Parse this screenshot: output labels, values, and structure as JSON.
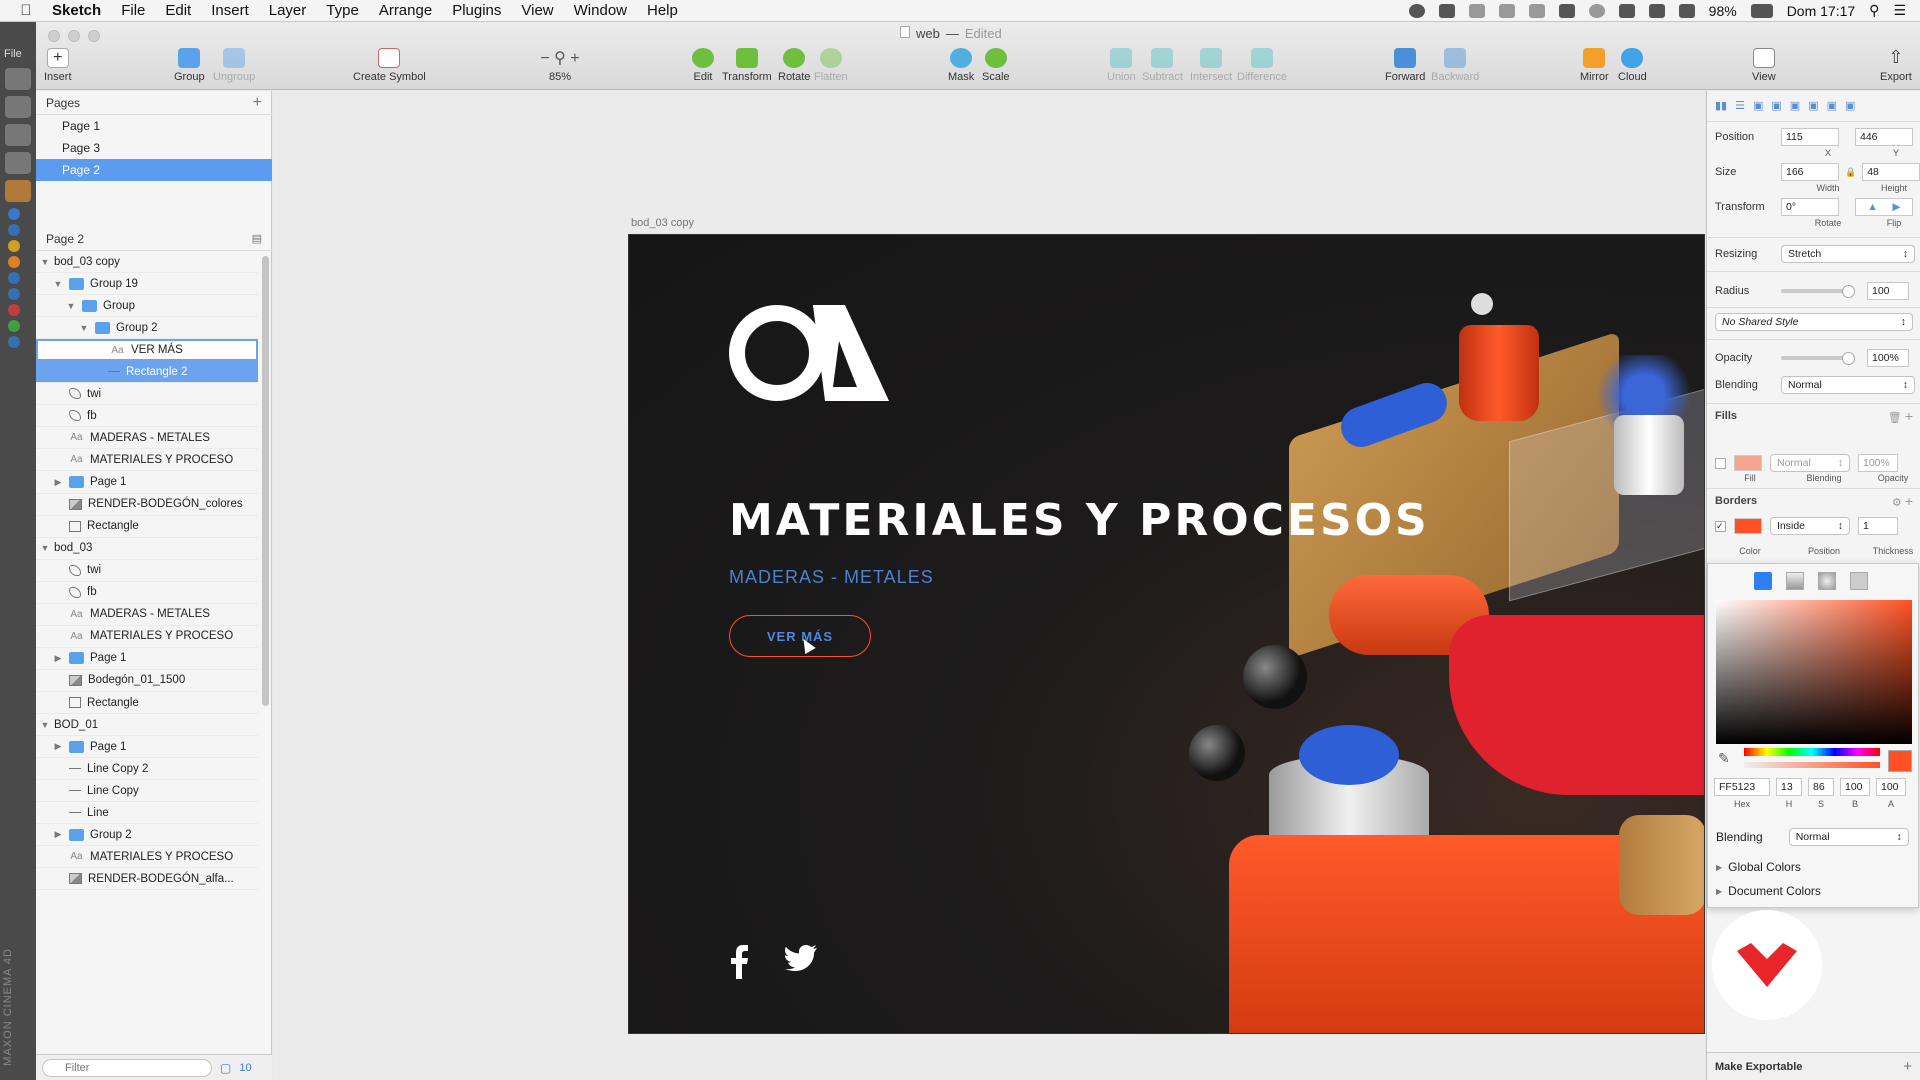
{
  "menubar": {
    "app": "Sketch",
    "items": [
      "File",
      "Edit",
      "Insert",
      "Layer",
      "Type",
      "Arrange",
      "Plugins",
      "View",
      "Window",
      "Help"
    ],
    "battery": "98%",
    "clock": "Dom 17:17"
  },
  "window": {
    "title": "web",
    "status": "Edited"
  },
  "toolbar": {
    "insert": "Insert",
    "group": "Group",
    "ungroup": "Ungroup",
    "create_symbol": "Create Symbol",
    "zoom": "85%",
    "edit": "Edit",
    "transform": "Transform",
    "rotate": "Rotate",
    "flatten": "Flatten",
    "mask": "Mask",
    "scale": "Scale",
    "union": "Union",
    "subtract": "Subtract",
    "intersect": "Intersect",
    "difference": "Difference",
    "forward": "Forward",
    "backward": "Backward",
    "mirror": "Mirror",
    "cloud": "Cloud",
    "view": "View",
    "export": "Export"
  },
  "dock": {
    "file_label": "File",
    "brand": "MAXON CINEMA 4D"
  },
  "pages": {
    "header": "Pages",
    "items": [
      {
        "label": "Page 1",
        "selected": false
      },
      {
        "label": "Page 3",
        "selected": false
      },
      {
        "label": "Page 2",
        "selected": true
      }
    ]
  },
  "layers": {
    "header": "Page 2",
    "items": [
      {
        "label": "bod_03 copy",
        "indent": 0,
        "icon": "none",
        "tri": "open"
      },
      {
        "label": "Group 19",
        "indent": 1,
        "icon": "folder",
        "tri": "open"
      },
      {
        "label": "Group",
        "indent": 2,
        "icon": "folder",
        "tri": "open"
      },
      {
        "label": "Group 2",
        "indent": 3,
        "icon": "folder",
        "tri": "open"
      },
      {
        "label": "VER MÁS",
        "indent": 4,
        "icon": "text",
        "tri": "none",
        "state": "selbox"
      },
      {
        "label": "Rectangle 2",
        "indent": 4,
        "icon": "line",
        "tri": "none",
        "state": "sel"
      },
      {
        "label": "twi",
        "indent": 1,
        "icon": "path",
        "tri": "none"
      },
      {
        "label": "fb",
        "indent": 1,
        "icon": "path",
        "tri": "none"
      },
      {
        "label": "MADERAS - METALES",
        "indent": 1,
        "icon": "text",
        "tri": "none"
      },
      {
        "label": "MATERIALES Y PROCESO",
        "indent": 1,
        "icon": "text",
        "tri": "none"
      },
      {
        "label": "Page 1",
        "indent": 1,
        "icon": "folder",
        "tri": "closed"
      },
      {
        "label": "RENDER-BODEGÓN_colores",
        "indent": 1,
        "icon": "img",
        "tri": "none"
      },
      {
        "label": "Rectangle",
        "indent": 1,
        "icon": "rect",
        "tri": "none"
      },
      {
        "label": "bod_03",
        "indent": 0,
        "icon": "none",
        "tri": "open"
      },
      {
        "label": "twi",
        "indent": 1,
        "icon": "path",
        "tri": "none"
      },
      {
        "label": "fb",
        "indent": 1,
        "icon": "path",
        "tri": "none"
      },
      {
        "label": "MADERAS - METALES",
        "indent": 1,
        "icon": "text",
        "tri": "none"
      },
      {
        "label": "MATERIALES Y PROCESO",
        "indent": 1,
        "icon": "text",
        "tri": "none"
      },
      {
        "label": "Page 1",
        "indent": 1,
        "icon": "folder",
        "tri": "closed"
      },
      {
        "label": "Bodegón_01_1500",
        "indent": 1,
        "icon": "img",
        "tri": "none"
      },
      {
        "label": "Rectangle",
        "indent": 1,
        "icon": "rect",
        "tri": "none"
      },
      {
        "label": "BOD_01",
        "indent": 0,
        "icon": "none",
        "tri": "open"
      },
      {
        "label": "Page 1",
        "indent": 1,
        "icon": "folder",
        "tri": "closed"
      },
      {
        "label": "Line Copy 2",
        "indent": 1,
        "icon": "line",
        "tri": "none"
      },
      {
        "label": "Line Copy",
        "indent": 1,
        "icon": "line",
        "tri": "none"
      },
      {
        "label": "Line",
        "indent": 1,
        "icon": "line",
        "tri": "none"
      },
      {
        "label": "Group 2",
        "indent": 1,
        "icon": "folder",
        "tri": "closed"
      },
      {
        "label": "MATERIALES Y PROCESO",
        "indent": 1,
        "icon": "text",
        "tri": "none"
      },
      {
        "label": "RENDER-BODEGÓN_alfa...",
        "indent": 1,
        "icon": "img",
        "tri": "none"
      }
    ]
  },
  "filter": {
    "placeholder": "Filter",
    "count": "10"
  },
  "artboard": {
    "label": "bod_03 copy",
    "heading": "MATERIALES Y PROCESOS",
    "subheading": "MADERAS - METALES",
    "button": "VER MÁS",
    "accent": "#ff5123",
    "blue": "#4f7fd0"
  },
  "inspector": {
    "position_label": "Position",
    "x": "115",
    "y": "446",
    "x_sub": "X",
    "y_sub": "Y",
    "size_label": "Size",
    "width": "166",
    "height": "48",
    "width_sub": "Width",
    "height_sub": "Height",
    "transform_label": "Transform",
    "rotate": "0°",
    "rotate_sub": "Rotate",
    "flip_sub": "Flip",
    "resizing_label": "Resizing",
    "resizing": "Stretch",
    "radius_label": "Radius",
    "radius": "100",
    "shared_style": "No Shared Style",
    "opacity_label": "Opacity",
    "opacity": "100%",
    "blending_label": "Blending",
    "blending": "Normal",
    "fills_label": "Fills",
    "fill_blending": "Normal",
    "fill_opacity": "100%",
    "fill_sub": "Fill",
    "fill_blending_sub": "Blending",
    "fill_opacity_sub": "Opacity",
    "borders_label": "Borders",
    "border_position": "Inside",
    "border_thickness": "1",
    "border_color_sub": "Color",
    "border_position_sub": "Position",
    "border_thickness_sub": "Thickness"
  },
  "colorpicker": {
    "hex": "FF5123",
    "h": "13",
    "s": "86",
    "b": "100",
    "a": "100",
    "hex_lbl": "Hex",
    "h_lbl": "H",
    "s_lbl": "S",
    "b_lbl": "B",
    "a_lbl": "A",
    "blending_label": "Blending",
    "blending": "Normal",
    "global_colors": "Global Colors",
    "document_colors": "Document Colors"
  },
  "make_exportable": "Make Exportable"
}
